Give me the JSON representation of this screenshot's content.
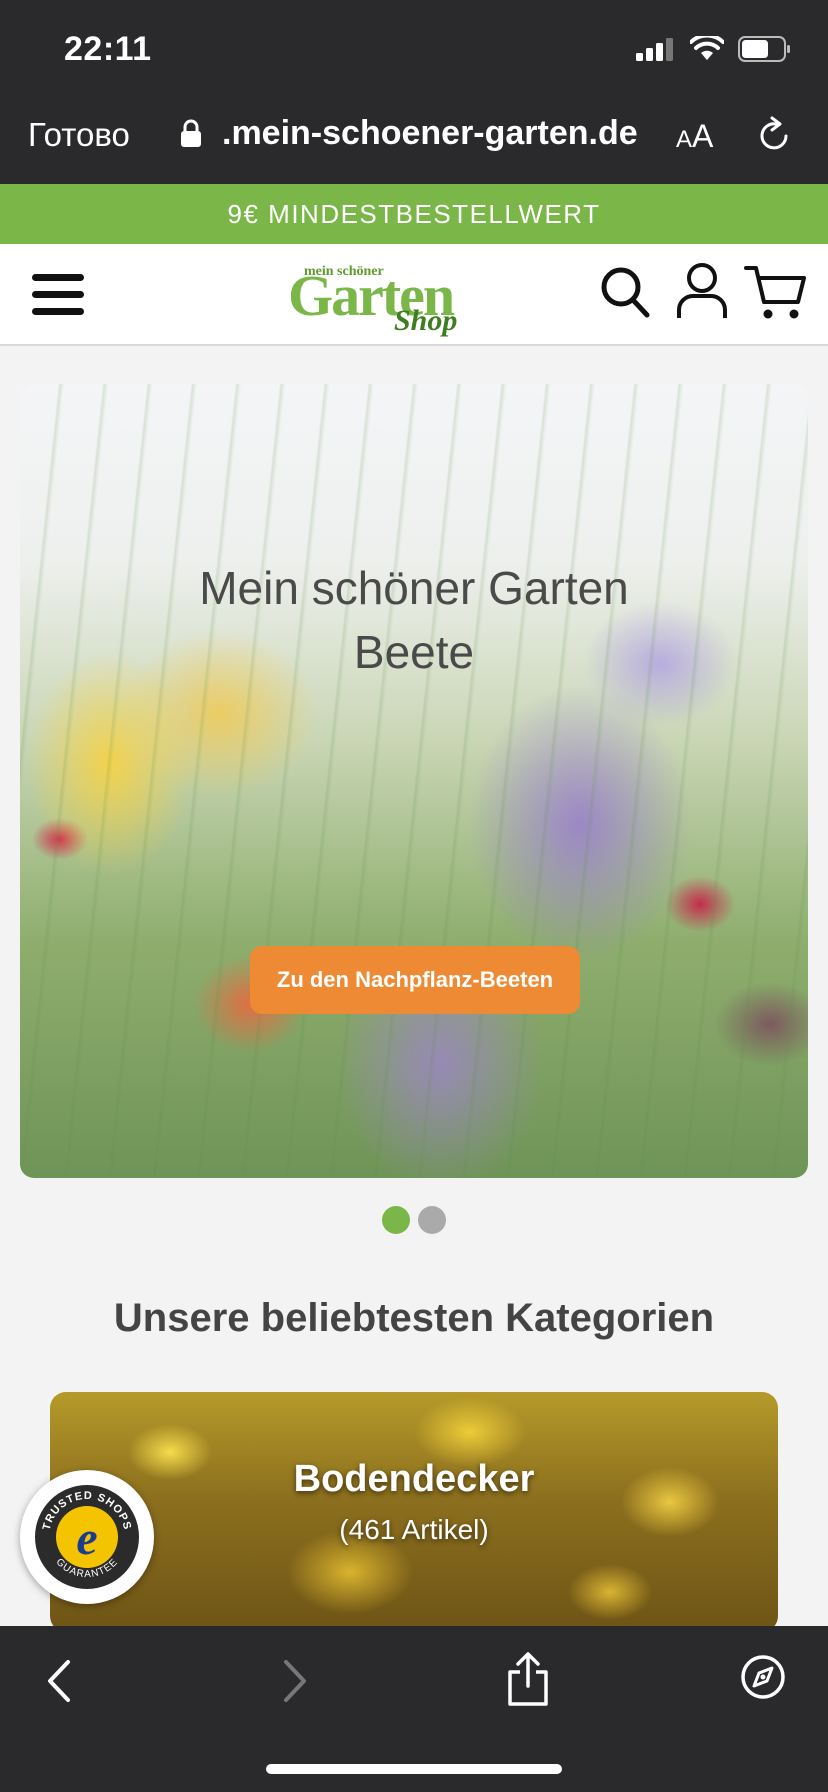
{
  "status_bar": {
    "time": "22:11"
  },
  "browser": {
    "done_label": "Готово",
    "url": ".mein-schoener-garten.de",
    "text_size_label_small": "A",
    "text_size_label_big": "A"
  },
  "promo_banner": {
    "text": "9€ MINDESTBESTELLWERT"
  },
  "header": {
    "logo_small": "mein schöner",
    "logo_big": "Garten",
    "logo_shop": "Shop"
  },
  "hero": {
    "title_line1": "Mein schöner Garten",
    "title_line2": "Beete",
    "button_label": "Zu den Nachpflanz-Beeten",
    "slide_count": 2,
    "active_slide": 1
  },
  "categories": {
    "heading": "Unsere beliebtesten Kategorien",
    "items": [
      {
        "name": "Bodendecker",
        "count": "(461 Artikel)"
      }
    ]
  },
  "colors": {
    "accent_green": "#7ab648",
    "button_orange": "#ee8a34",
    "browser_chrome": "#2a2a2d"
  }
}
